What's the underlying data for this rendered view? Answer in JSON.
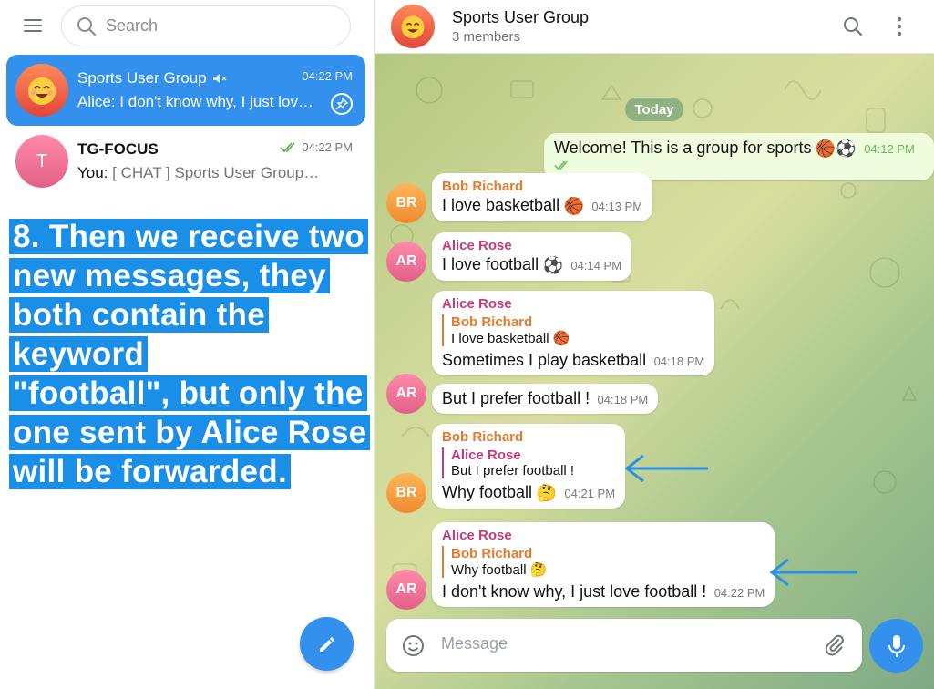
{
  "sidebar": {
    "search_placeholder": "Search",
    "chats": [
      {
        "title": "Sports User Group",
        "time": "04:22 PM",
        "preview": "Alice: I don't know why, I just love football !",
        "active": true,
        "muted": true,
        "pinned": true
      },
      {
        "title": "TG-FOCUS",
        "avatar_letter": "T",
        "time": "04:22 PM",
        "preview_prefix": "You: ",
        "preview": "[ CHAT ] Sports User Group [ SENDER ] Alice Rose",
        "read": true
      }
    ],
    "annotation": [
      "8.  Then we receive two",
      "new messages, they",
      "both contain the keyword",
      "\"football\", but only the",
      "one sent by Alice Rose",
      "will be forwarded."
    ]
  },
  "header": {
    "title": "Sports User Group",
    "subtitle": "3 members"
  },
  "chat": {
    "date_label": "Today",
    "messages": [
      {
        "text": "Welcome! This is a group for sports",
        "emoji": "🏀⚽",
        "time": "04:12 PM",
        "outgoing": true
      },
      {
        "sender": "Bob Richard",
        "avatar": "BR",
        "text": "I love basketball",
        "emoji": "🏀",
        "time": "04:13 PM"
      },
      {
        "sender": "Alice Rose",
        "avatar": "AR",
        "text": "I love football",
        "emoji": "⚽",
        "time": "04:14 PM"
      },
      {
        "sender": "Alice Rose",
        "reply_name": "Bob Richard",
        "reply_text": "I love basketball 🏀",
        "text": "Sometimes I play basketball",
        "time": "04:18 PM"
      },
      {
        "avatar": "AR",
        "text": "But I prefer football !",
        "time": "04:18 PM"
      },
      {
        "sender": "Bob Richard",
        "avatar": "BR",
        "reply_name": "Alice Rose",
        "reply_text": "But I prefer football !",
        "text": "Why football",
        "emoji": "🤔",
        "time": "04:21 PM"
      },
      {
        "sender": "Alice Rose",
        "avatar": "AR",
        "reply_name": "Bob Richard",
        "reply_text": "Why football 🤔",
        "text": "I don't know why, I just love football !",
        "time": "04:22 PM"
      }
    ]
  },
  "composer": {
    "placeholder": "Message"
  },
  "colors": {
    "accent": "#3390ec",
    "orange_sender": "#e37b2e",
    "pink_sender": "#c03d78",
    "annotation_bg": "#1a8fe8"
  },
  "icons": [
    "menu-icon",
    "search-icon",
    "mute-icon",
    "pin-icon",
    "double-check-icon",
    "pencil-icon",
    "more-icon",
    "smile-icon",
    "paperclip-icon",
    "microphone-icon",
    "arrow-left-icon"
  ]
}
